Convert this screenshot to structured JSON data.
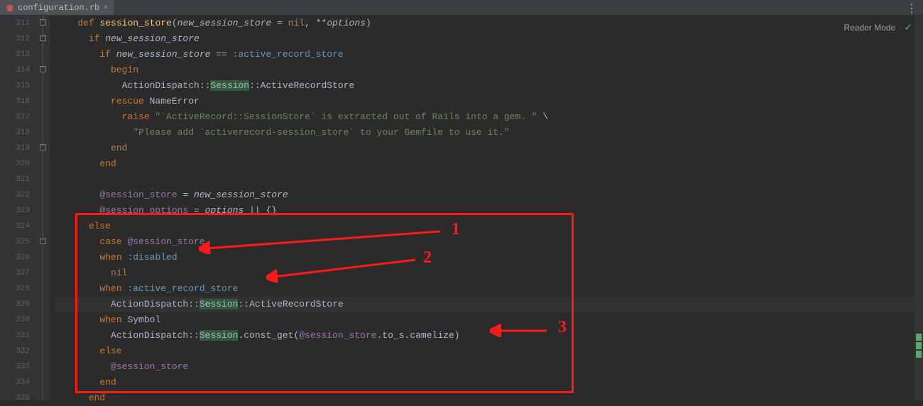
{
  "tab": {
    "name": "configuration.rb"
  },
  "reader_mode": "Reader Mode",
  "line_start": 311,
  "lines": [
    {
      "n": 311,
      "segs": [
        [
          "    ",
          ""
        ],
        [
          "def ",
          "kw"
        ],
        [
          "session_store",
          "def"
        ],
        [
          "(",
          ""
        ],
        [
          "new_session_store",
          "param"
        ],
        [
          " = ",
          "op"
        ],
        [
          "nil",
          "kw"
        ],
        [
          ", **",
          ""
        ],
        [
          "options",
          "param"
        ],
        [
          ")",
          ""
        ]
      ]
    },
    {
      "n": 312,
      "segs": [
        [
          "      ",
          ""
        ],
        [
          "if ",
          "kw"
        ],
        [
          "new_session_store",
          "ital"
        ]
      ]
    },
    {
      "n": 313,
      "segs": [
        [
          "        ",
          ""
        ],
        [
          "if ",
          "kw"
        ],
        [
          "new_session_store",
          "ital"
        ],
        [
          " == ",
          ""
        ],
        [
          ":active_record_store",
          "sym"
        ]
      ]
    },
    {
      "n": 314,
      "segs": [
        [
          "          ",
          ""
        ],
        [
          "begin",
          "kw"
        ]
      ]
    },
    {
      "n": 315,
      "segs": [
        [
          "            ActionDispatch::",
          ""
        ],
        [
          "Session",
          "hl"
        ],
        [
          "::",
          ""
        ],
        [
          "ActiveRecordStore",
          ""
        ]
      ]
    },
    {
      "n": 316,
      "segs": [
        [
          "          ",
          ""
        ],
        [
          "rescue ",
          "kw"
        ],
        [
          "NameError",
          ""
        ]
      ]
    },
    {
      "n": 317,
      "segs": [
        [
          "            ",
          ""
        ],
        [
          "raise ",
          "kw"
        ],
        [
          "\"`ActiveRecord::SessionStore` is extracted out of Rails into a gem. \"",
          "str"
        ],
        [
          " \\",
          ""
        ]
      ]
    },
    {
      "n": 318,
      "segs": [
        [
          "              ",
          ""
        ],
        [
          "\"Please add `activerecord-session_store` to your Gemfile to use it.\"",
          "str"
        ]
      ]
    },
    {
      "n": 319,
      "segs": [
        [
          "          ",
          ""
        ],
        [
          "end",
          "kw"
        ]
      ]
    },
    {
      "n": 320,
      "segs": [
        [
          "        ",
          ""
        ],
        [
          "end",
          "kw"
        ]
      ]
    },
    {
      "n": 321,
      "segs": [
        [
          "",
          ""
        ]
      ]
    },
    {
      "n": 322,
      "segs": [
        [
          "        ",
          ""
        ],
        [
          "@session_store",
          "ivar"
        ],
        [
          " = ",
          ""
        ],
        [
          "new_session_store",
          "ital"
        ]
      ]
    },
    {
      "n": 323,
      "segs": [
        [
          "        ",
          ""
        ],
        [
          "@session_options",
          "ivar"
        ],
        [
          " = ",
          ""
        ],
        [
          "options",
          "ital"
        ],
        [
          " || {}",
          ""
        ]
      ]
    },
    {
      "n": 324,
      "segs": [
        [
          "      ",
          ""
        ],
        [
          "else",
          "kw"
        ]
      ]
    },
    {
      "n": 325,
      "segs": [
        [
          "        ",
          ""
        ],
        [
          "case ",
          "kw"
        ],
        [
          "@session_store",
          "ivar"
        ]
      ]
    },
    {
      "n": 326,
      "segs": [
        [
          "        ",
          ""
        ],
        [
          "when ",
          "kw"
        ],
        [
          ":disabled",
          "sym"
        ]
      ]
    },
    {
      "n": 327,
      "segs": [
        [
          "          ",
          ""
        ],
        [
          "nil",
          "kw"
        ]
      ]
    },
    {
      "n": 328,
      "segs": [
        [
          "        ",
          ""
        ],
        [
          "when ",
          "kw"
        ],
        [
          ":active_record_store",
          "sym"
        ]
      ]
    },
    {
      "n": 329,
      "sel": true,
      "segs": [
        [
          "          ActionDispatch::",
          ""
        ],
        [
          "Session",
          "hl"
        ],
        [
          "::",
          ""
        ],
        [
          "ActiveRecordStore",
          ""
        ]
      ]
    },
    {
      "n": 330,
      "segs": [
        [
          "        ",
          ""
        ],
        [
          "when ",
          "kw"
        ],
        [
          "Symbol",
          ""
        ]
      ]
    },
    {
      "n": 331,
      "segs": [
        [
          "          ActionDispatch::",
          ""
        ],
        [
          "Session",
          "hl"
        ],
        [
          ".const_get(",
          ""
        ],
        [
          "@session_store",
          "ivar"
        ],
        [
          ".to_s.camelize)",
          ""
        ]
      ]
    },
    {
      "n": 332,
      "segs": [
        [
          "        ",
          ""
        ],
        [
          "else",
          "kw"
        ]
      ]
    },
    {
      "n": 333,
      "segs": [
        [
          "          ",
          ""
        ],
        [
          "@session_store",
          "ivar"
        ]
      ]
    },
    {
      "n": 334,
      "segs": [
        [
          "        ",
          ""
        ],
        [
          "end",
          "kw"
        ]
      ]
    },
    {
      "n": 335,
      "segs": [
        [
          "      ",
          ""
        ],
        [
          "end",
          "kw"
        ]
      ]
    }
  ],
  "annotations": {
    "labels": [
      "1",
      "2",
      "3"
    ]
  }
}
